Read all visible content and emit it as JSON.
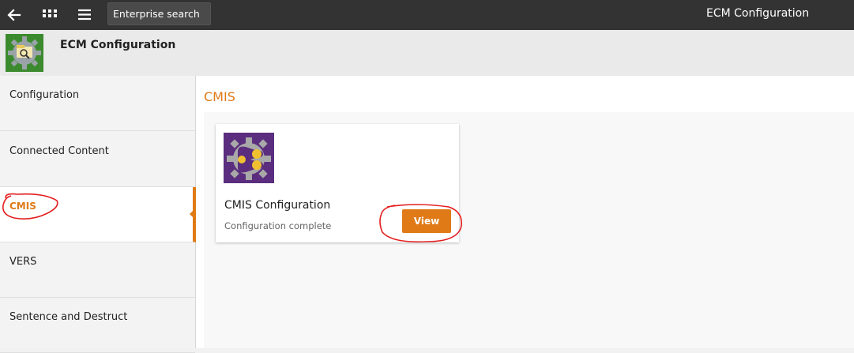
{
  "topbar": {
    "back_icon": "arrow-left-icon",
    "apps_icon": "grid-icon",
    "menu_icon": "hamburger-icon",
    "search_label": "Enterprise search",
    "title": "ECM Configuration"
  },
  "header": {
    "title": "ECM Configuration",
    "app_icon": "gear-search-icon"
  },
  "sidebar": {
    "items": [
      {
        "label": "Configuration"
      },
      {
        "label": "Connected Content"
      },
      {
        "label": "CMIS"
      },
      {
        "label": "VERS"
      },
      {
        "label": "Sentence and Destruct"
      }
    ],
    "active": "CMIS"
  },
  "main": {
    "section_title": "CMIS",
    "card": {
      "title": "CMIS Configuration",
      "status": "Configuration complete",
      "button_label": "View",
      "icon": "cmis-gear-icon"
    }
  },
  "colors": {
    "accent": "#e07a16",
    "topbar": "#333333",
    "annotation": "#e31e1e"
  }
}
